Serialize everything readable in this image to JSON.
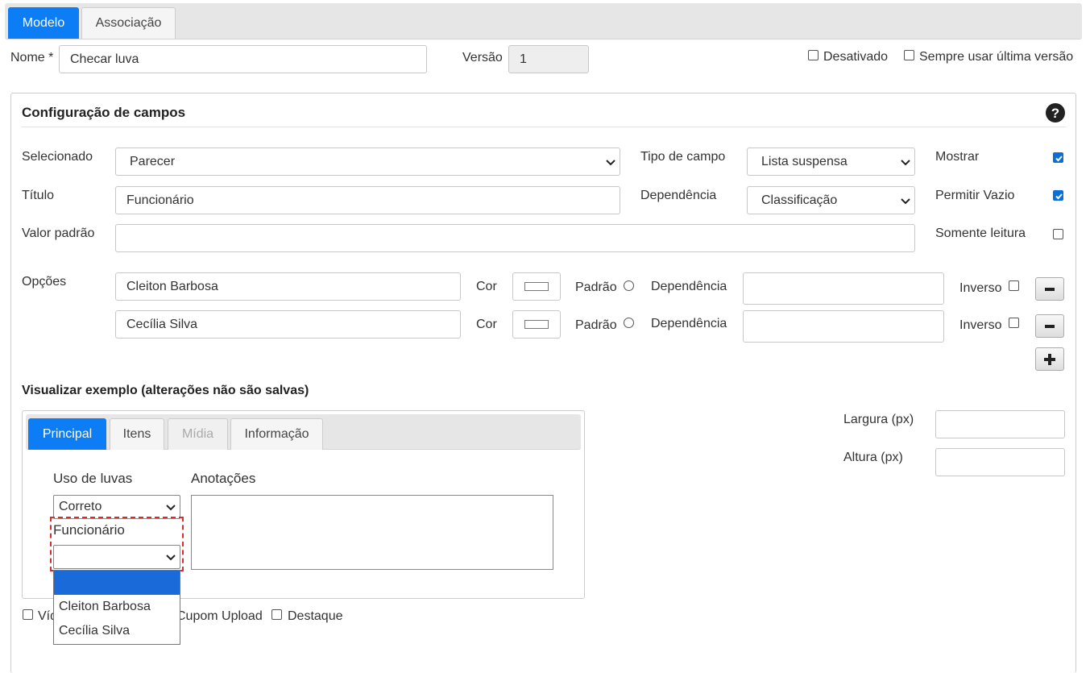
{
  "tabs": [
    {
      "label": "Modelo",
      "active": true
    },
    {
      "label": "Associação",
      "active": false
    }
  ],
  "header": {
    "name_label": "Nome *",
    "name_value": "Checar luva",
    "version_label": "Versão",
    "version_value": "1",
    "disabled_label": "Desativado",
    "always_last_label": "Sempre usar última versão"
  },
  "config": {
    "title": "Configuração de campos",
    "help_icon": "question-circle-icon",
    "selected_label": "Selecionado",
    "selected_value": "Parecer",
    "field_type_label": "Tipo de campo",
    "field_type_value": "Lista suspensa",
    "show_label": "Mostrar",
    "show_checked": true,
    "title_label": "Título",
    "title_value": "Funcionário",
    "dependency_label": "Dependência",
    "dependency_value": "Classificação",
    "allow_empty_label": "Permitir Vazio",
    "allow_empty_checked": true,
    "default_label": "Valor padrão",
    "default_value": "",
    "readonly_label": "Somente leitura",
    "readonly_checked": false,
    "options_label": "Opções",
    "options": [
      {
        "value": "Cleiton Barbosa",
        "color_label": "Cor",
        "default_label": "Padrão",
        "dependency_label": "Dependência",
        "inverse_label": "Inverso"
      },
      {
        "value": "Cecília Silva",
        "color_label": "Cor",
        "default_label": "Padrão",
        "dependency_label": "Dependência",
        "inverse_label": "Inverso"
      }
    ]
  },
  "preview": {
    "title": "Visualizar exemplo (alterações não são salvas)",
    "tabs": [
      {
        "label": "Principal",
        "state": "active"
      },
      {
        "label": "Itens",
        "state": "normal"
      },
      {
        "label": "Mídia",
        "state": "disabled"
      },
      {
        "label": "Informação",
        "state": "normal"
      }
    ],
    "glove_label": "Uso de luvas",
    "glove_value": "Correto",
    "notes_label": "Anotações",
    "employee_label": "Funcionário",
    "employee_value": "",
    "dropdown_options": [
      "",
      "Cleiton Barbosa",
      "Cecília Silva"
    ],
    "bottom_check1": "Víd",
    "bottom_check2": "Cupom Upload",
    "bottom_check3": "Destaque"
  },
  "size": {
    "width_label": "Largura (px)",
    "height_label": "Altura (px)",
    "width_value": "",
    "height_value": ""
  },
  "colors": {
    "accent": "#0d7df5",
    "selected_option": "#1a6ad9",
    "highlight_border": "#d32f2f"
  }
}
